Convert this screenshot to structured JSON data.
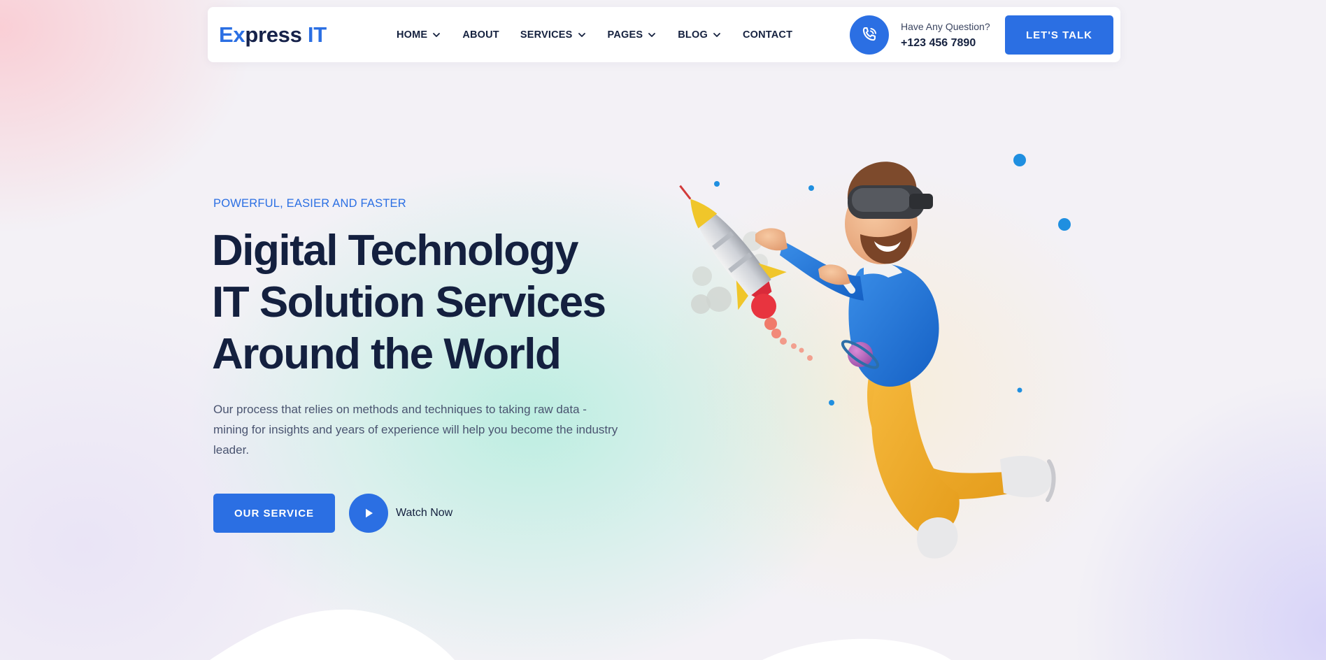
{
  "header": {
    "logo": {
      "part1": "Ex",
      "part2": "press ",
      "part3": "IT"
    },
    "nav": [
      {
        "label": "HOME",
        "has_dropdown": true
      },
      {
        "label": "ABOUT",
        "has_dropdown": false
      },
      {
        "label": "SERVICES",
        "has_dropdown": true
      },
      {
        "label": "PAGES",
        "has_dropdown": true
      },
      {
        "label": "BLOG",
        "has_dropdown": true
      },
      {
        "label": "CONTACT",
        "has_dropdown": false
      }
    ],
    "contact": {
      "label": "Have Any Question?",
      "number": "+123 456 7890",
      "icon": "phone-call-icon"
    },
    "cta_label": "LET'S TALK"
  },
  "hero": {
    "eyebrow": "POWERFUL, EASIER AND FASTER",
    "title_lines": [
      "Digital Technology",
      "IT Solution Services",
      "Around the World"
    ],
    "description": "Our process that relies on methods and techniques to taking raw data - mining for insights and years of experience will help you become the industry leader.",
    "primary_button": "OUR SERVICE",
    "video_label": "Watch Now",
    "illustration": "vr-man-flying-with-rocket-illustration"
  },
  "colors": {
    "primary": "#2b6fe3",
    "heading": "#14203f",
    "body_text": "#4a5470"
  }
}
